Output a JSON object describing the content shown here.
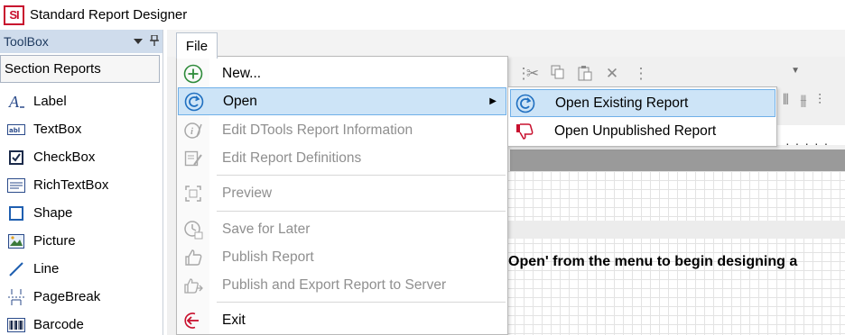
{
  "window": {
    "title": "Standard Report Designer",
    "logo_text": "SI"
  },
  "toolbox": {
    "title": "ToolBox",
    "dropdown_icon": "chevron-down-icon",
    "pin_icon": "pin-icon",
    "section": "Section Reports",
    "items": [
      {
        "label": "Label",
        "icon": "label-icon"
      },
      {
        "label": "TextBox",
        "icon": "textbox-icon"
      },
      {
        "label": "CheckBox",
        "icon": "checkbox-icon"
      },
      {
        "label": "RichTextBox",
        "icon": "richtextbox-icon"
      },
      {
        "label": "Shape",
        "icon": "shape-icon"
      },
      {
        "label": "Picture",
        "icon": "picture-icon"
      },
      {
        "label": "Line",
        "icon": "line-icon"
      },
      {
        "label": "PageBreak",
        "icon": "pagebreak-icon"
      },
      {
        "label": "Barcode",
        "icon": "barcode-icon"
      }
    ]
  },
  "menubar": {
    "file_label": "File"
  },
  "file_menu": {
    "items": [
      {
        "label": "New...",
        "icon": "new-icon",
        "enabled": true
      },
      {
        "label": "Open",
        "icon": "open-icon",
        "enabled": true,
        "highlighted": true,
        "has_submenu": true
      },
      {
        "label": "Edit DTools Report Information",
        "icon": "info-icon",
        "enabled": false
      },
      {
        "label": "Edit Report Definitions",
        "icon": "edit-icon",
        "enabled": false
      },
      {
        "label": "Preview",
        "icon": "preview-icon",
        "enabled": false
      },
      {
        "label": "Save for Later",
        "icon": "save-later-icon",
        "enabled": false
      },
      {
        "label": "Publish Report",
        "icon": "thumbs-up-icon",
        "enabled": false
      },
      {
        "label": "Publish and Export Report to Server",
        "icon": "export-icon",
        "enabled": false
      },
      {
        "label": "Exit",
        "icon": "exit-icon",
        "enabled": true
      }
    ]
  },
  "open_submenu": {
    "items": [
      {
        "label": "Open Existing Report",
        "icon": "open-icon",
        "highlighted": true
      },
      {
        "label": "Open Unpublished Report",
        "icon": "thumbs-down-icon"
      }
    ]
  },
  "designer": {
    "hint": "Open' from the menu to begin designing a"
  },
  "colors": {
    "highlight_bg": "#cde4f7",
    "highlight_border": "#6fb0e8",
    "header_bg": "#cfdcec"
  }
}
